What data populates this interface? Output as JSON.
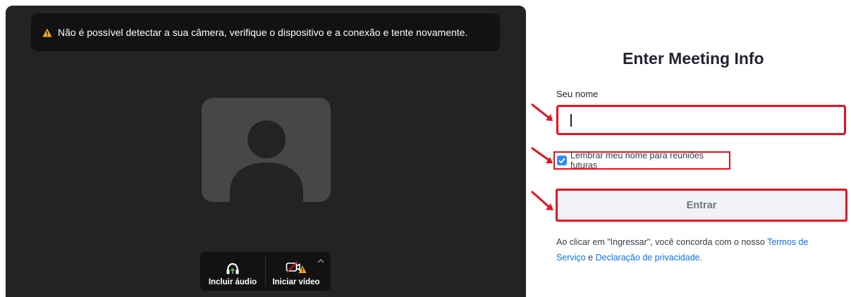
{
  "video": {
    "warning_icon": "warning-triangle-icon",
    "warning_text": "Não é possível detectar a sua câmera, verifique o dispositivo e a conexão e tente novamente.",
    "avatar_icon": "person-placeholder-icon",
    "controls": {
      "audio_label": "Incluir áudio",
      "video_label": "Iniciar vídeo",
      "audio_icon": "headphones-icon",
      "video_icon": "camera-off-icon",
      "more_icon": "chevron-up-icon"
    }
  },
  "form": {
    "title": "Enter Meeting Info",
    "name_label": "Seu nome",
    "name_value": "",
    "remember_label": "Lembrar meu nome para reuniões futuras",
    "remember_checked": true,
    "join_label": "Entrar",
    "terms_prefix": "Ao clicar em \"Ingressar\", você concorda com o nosso ",
    "terms_link": "Termos de Serviço",
    "terms_middle": " e ",
    "privacy_link": "Declaração de privacidade",
    "terms_suffix": "."
  },
  "colors": {
    "accent": "#2d8cff",
    "link": "#0e72ed",
    "highlight": "#e8101f",
    "warning": "#f5a623"
  }
}
